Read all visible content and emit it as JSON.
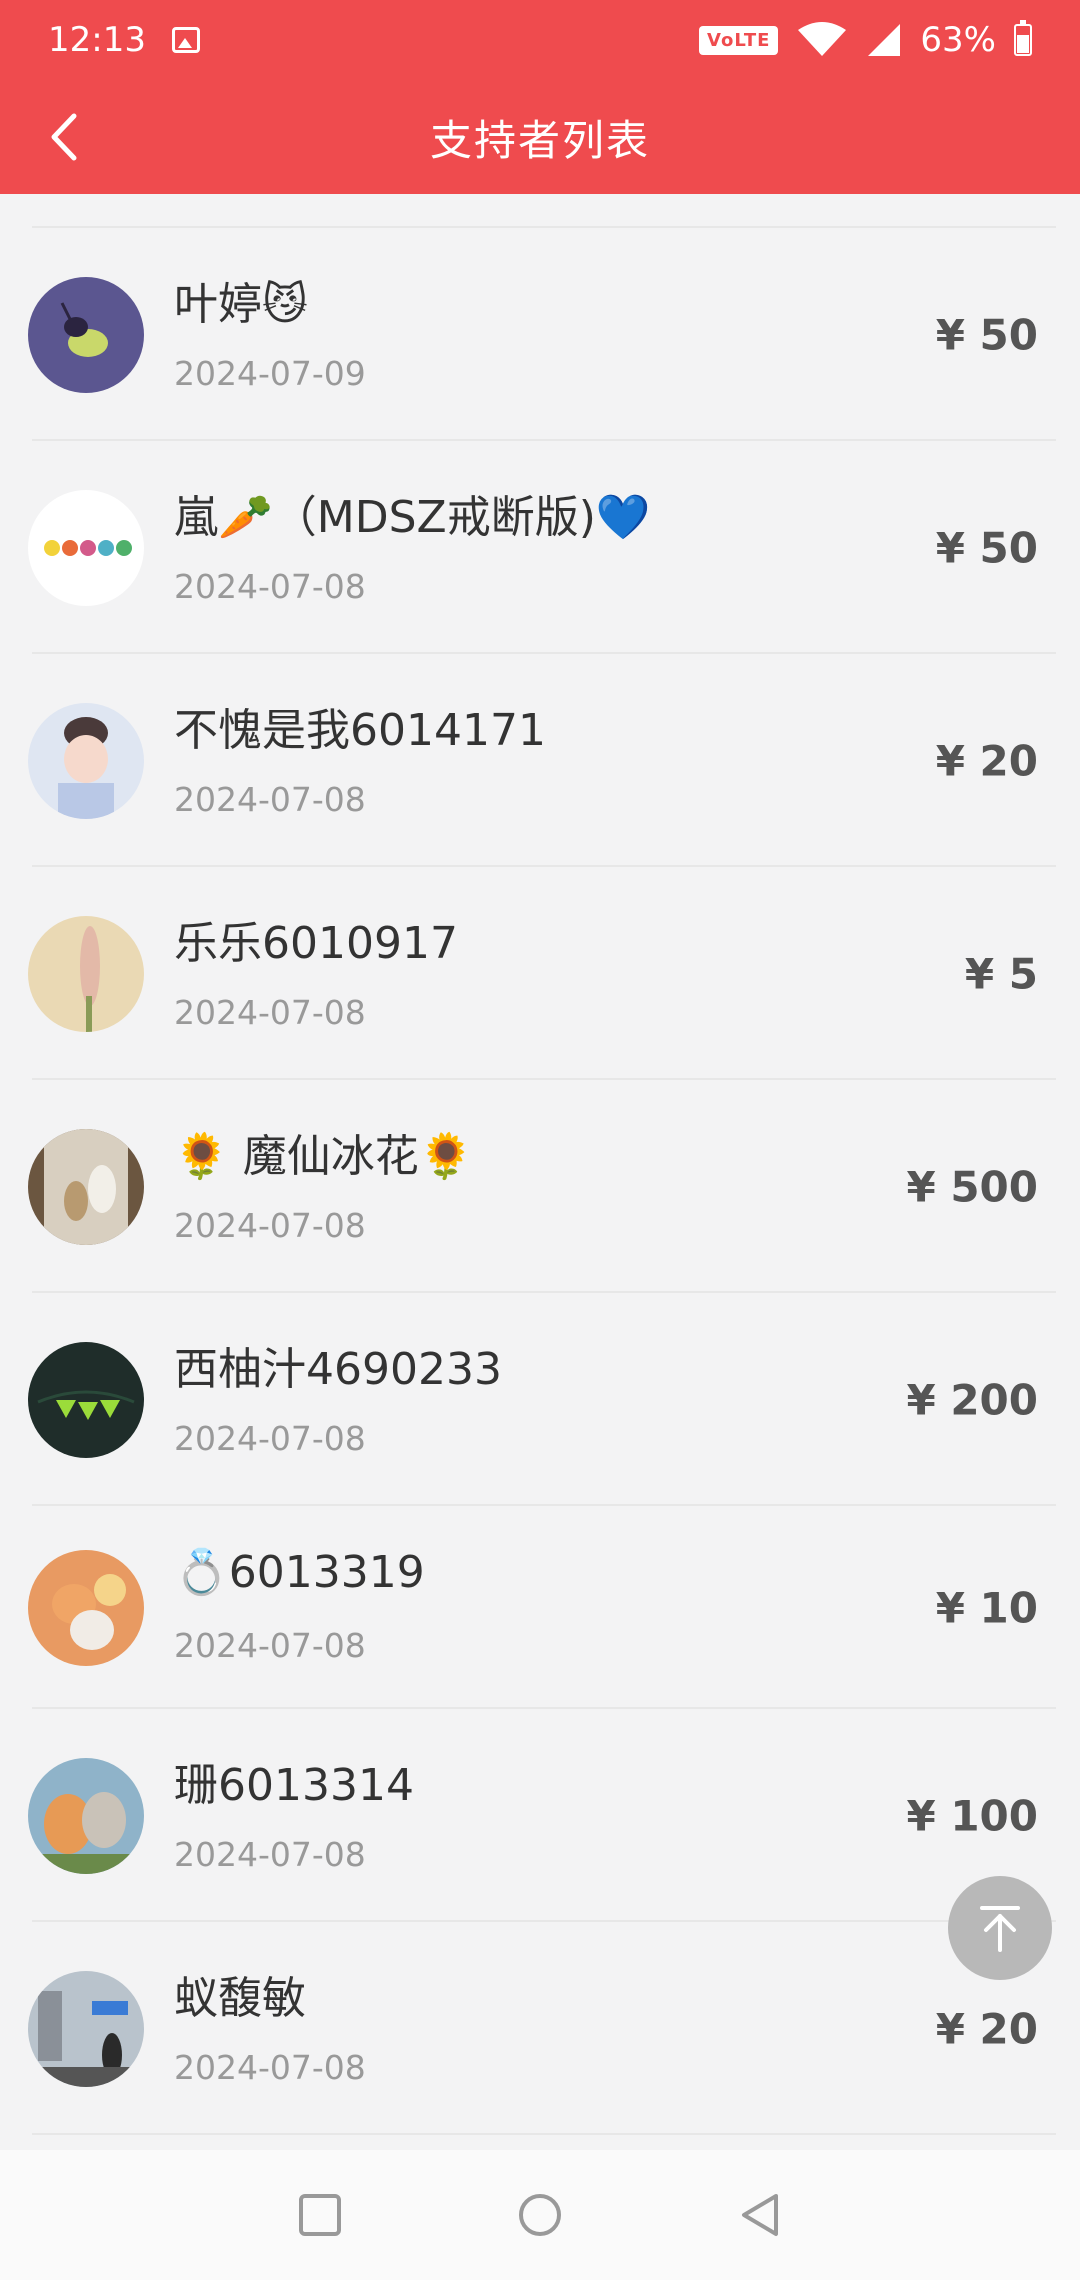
{
  "status_bar": {
    "time": "12:13",
    "network_badge": "VoLTE",
    "battery": "63%",
    "battery_level": 0.63,
    "icons": [
      "image-icon",
      "wifi-icon",
      "signal-icon",
      "battery-icon"
    ]
  },
  "header": {
    "title": "支持者列表",
    "back_icon": "chevron-left-icon"
  },
  "supporters": [
    {
      "name": "叶婷😼",
      "date": "2024-07-09",
      "amount": "¥ 50"
    },
    {
      "name": "嵐🥕（MDSZ戒断版)💙",
      "date": "2024-07-08",
      "amount": "¥ 50"
    },
    {
      "name": "不愧是我6014171",
      "date": "2024-07-08",
      "amount": "¥ 20"
    },
    {
      "name": "乐乐6010917",
      "date": "2024-07-08",
      "amount": "¥ 5"
    },
    {
      "name": "🌻 魔仙冰花🌻",
      "date": "2024-07-08",
      "amount": "¥ 500"
    },
    {
      "name": "西柚汁4690233",
      "date": "2024-07-08",
      "amount": "¥ 200"
    },
    {
      "name": "💍6013319",
      "date": "2024-07-08",
      "amount": "¥ 10"
    },
    {
      "name": "珊6013314",
      "date": "2024-07-08",
      "amount": "¥ 100"
    },
    {
      "name": "蚁馥敏",
      "date": "2024-07-08",
      "amount": "¥ 20"
    }
  ],
  "scroll_top_icon": "arrow-up-to-top-icon",
  "nav_bar": [
    "recents-square-icon",
    "home-circle-icon",
    "back-triangle-icon"
  ],
  "colors": {
    "accent": "#ef4b4e",
    "background": "#f3f3f4",
    "amount": "#555555",
    "date": "#999999"
  }
}
